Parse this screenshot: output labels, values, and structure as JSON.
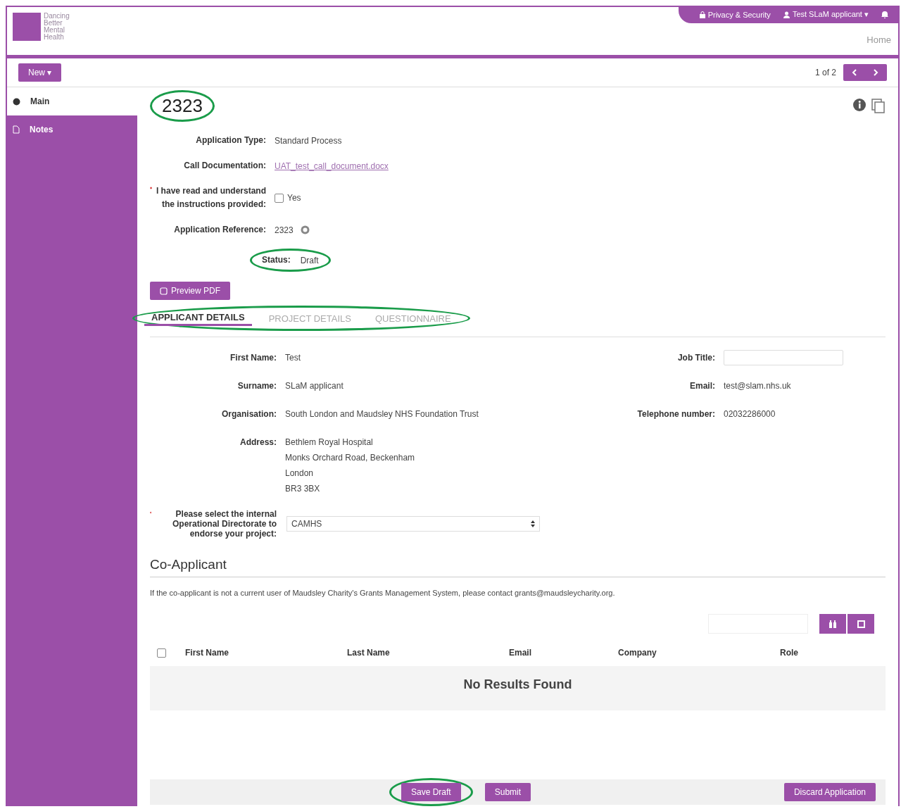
{
  "header": {
    "logo_text": "Dancing Better Mental Health",
    "top_links": [
      {
        "kind": "lock",
        "label": "Privacy & Security"
      },
      {
        "kind": "user",
        "label": "Test SLaM applicant ▾"
      }
    ],
    "home_link": "Home"
  },
  "toolbar": {
    "new_button": "New ▾",
    "pager": "1 of 2"
  },
  "sidebar": {
    "items": [
      {
        "label": "Main",
        "selected": true,
        "kind": "globe"
      },
      {
        "label": "Notes",
        "selected": false,
        "kind": "note"
      }
    ]
  },
  "record": {
    "title": "2323",
    "circled": true
  },
  "fields": [
    {
      "label": "Application Type:",
      "value": "Standard Process",
      "kind": "text"
    },
    {
      "label": "Call Documentation:",
      "value": "UAT_test_call_document.docx",
      "kind": "link"
    },
    {
      "label": "I have read and understand the instructions provided:",
      "value": "Yes",
      "kind": "checkbox",
      "required": true,
      "checked": false
    },
    {
      "label": "Application Reference:",
      "value": "2323",
      "kind": "help"
    },
    {
      "label": "Status:",
      "value": "Draft",
      "kind": "text",
      "circled": true
    }
  ],
  "preview_button": "Preview PDF",
  "tabs": {
    "circled": true,
    "items": [
      {
        "label": "APPLICANT DETAILS",
        "selected": true
      },
      {
        "label": "PROJECT DETAILS",
        "selected": false
      },
      {
        "label": "QUESTIONNAIRE",
        "selected": false
      }
    ]
  },
  "applicant_left": [
    {
      "label": "First Name:",
      "lines": [
        "Test"
      ]
    },
    {
      "label": "Surname:",
      "lines": [
        "SLaM applicant"
      ]
    },
    {
      "label": "Organisation:",
      "lines": [
        "South London and Maudsley NHS Foundation Trust"
      ]
    },
    {
      "label": "Address:",
      "lines": [
        "Bethlem Royal Hospital",
        "Monks Orchard Road, Beckenham",
        "London",
        "BR3 3BX"
      ]
    }
  ],
  "applicant_right": [
    {
      "label": "Job Title:",
      "kind": "input"
    },
    {
      "label": "Email:",
      "value": "test@slam.nhs.uk",
      "kind": "text"
    },
    {
      "label": "Telephone number:",
      "value": "02032286000",
      "kind": "text"
    }
  ],
  "directorate": {
    "required": true,
    "label": "Please select the internal Operational Directorate to endorse your project:",
    "value": "CAMHS"
  },
  "co_applicant": {
    "heading": "Co-Applicant",
    "note": "If the co-applicant is not a current user of Maudsley Charity's Grants Management System, please contact grants@maudsleycharity.org.",
    "select_all_checked": false,
    "columns": [
      "First Name",
      "Last Name",
      "Email",
      "Company",
      "Role"
    ],
    "empty_text": "No Results Found"
  },
  "footer": {
    "buttons": [
      {
        "label": "Save Draft",
        "circled": true
      },
      {
        "label": "Submit",
        "circled": false
      }
    ],
    "discard": "Discard Application"
  }
}
